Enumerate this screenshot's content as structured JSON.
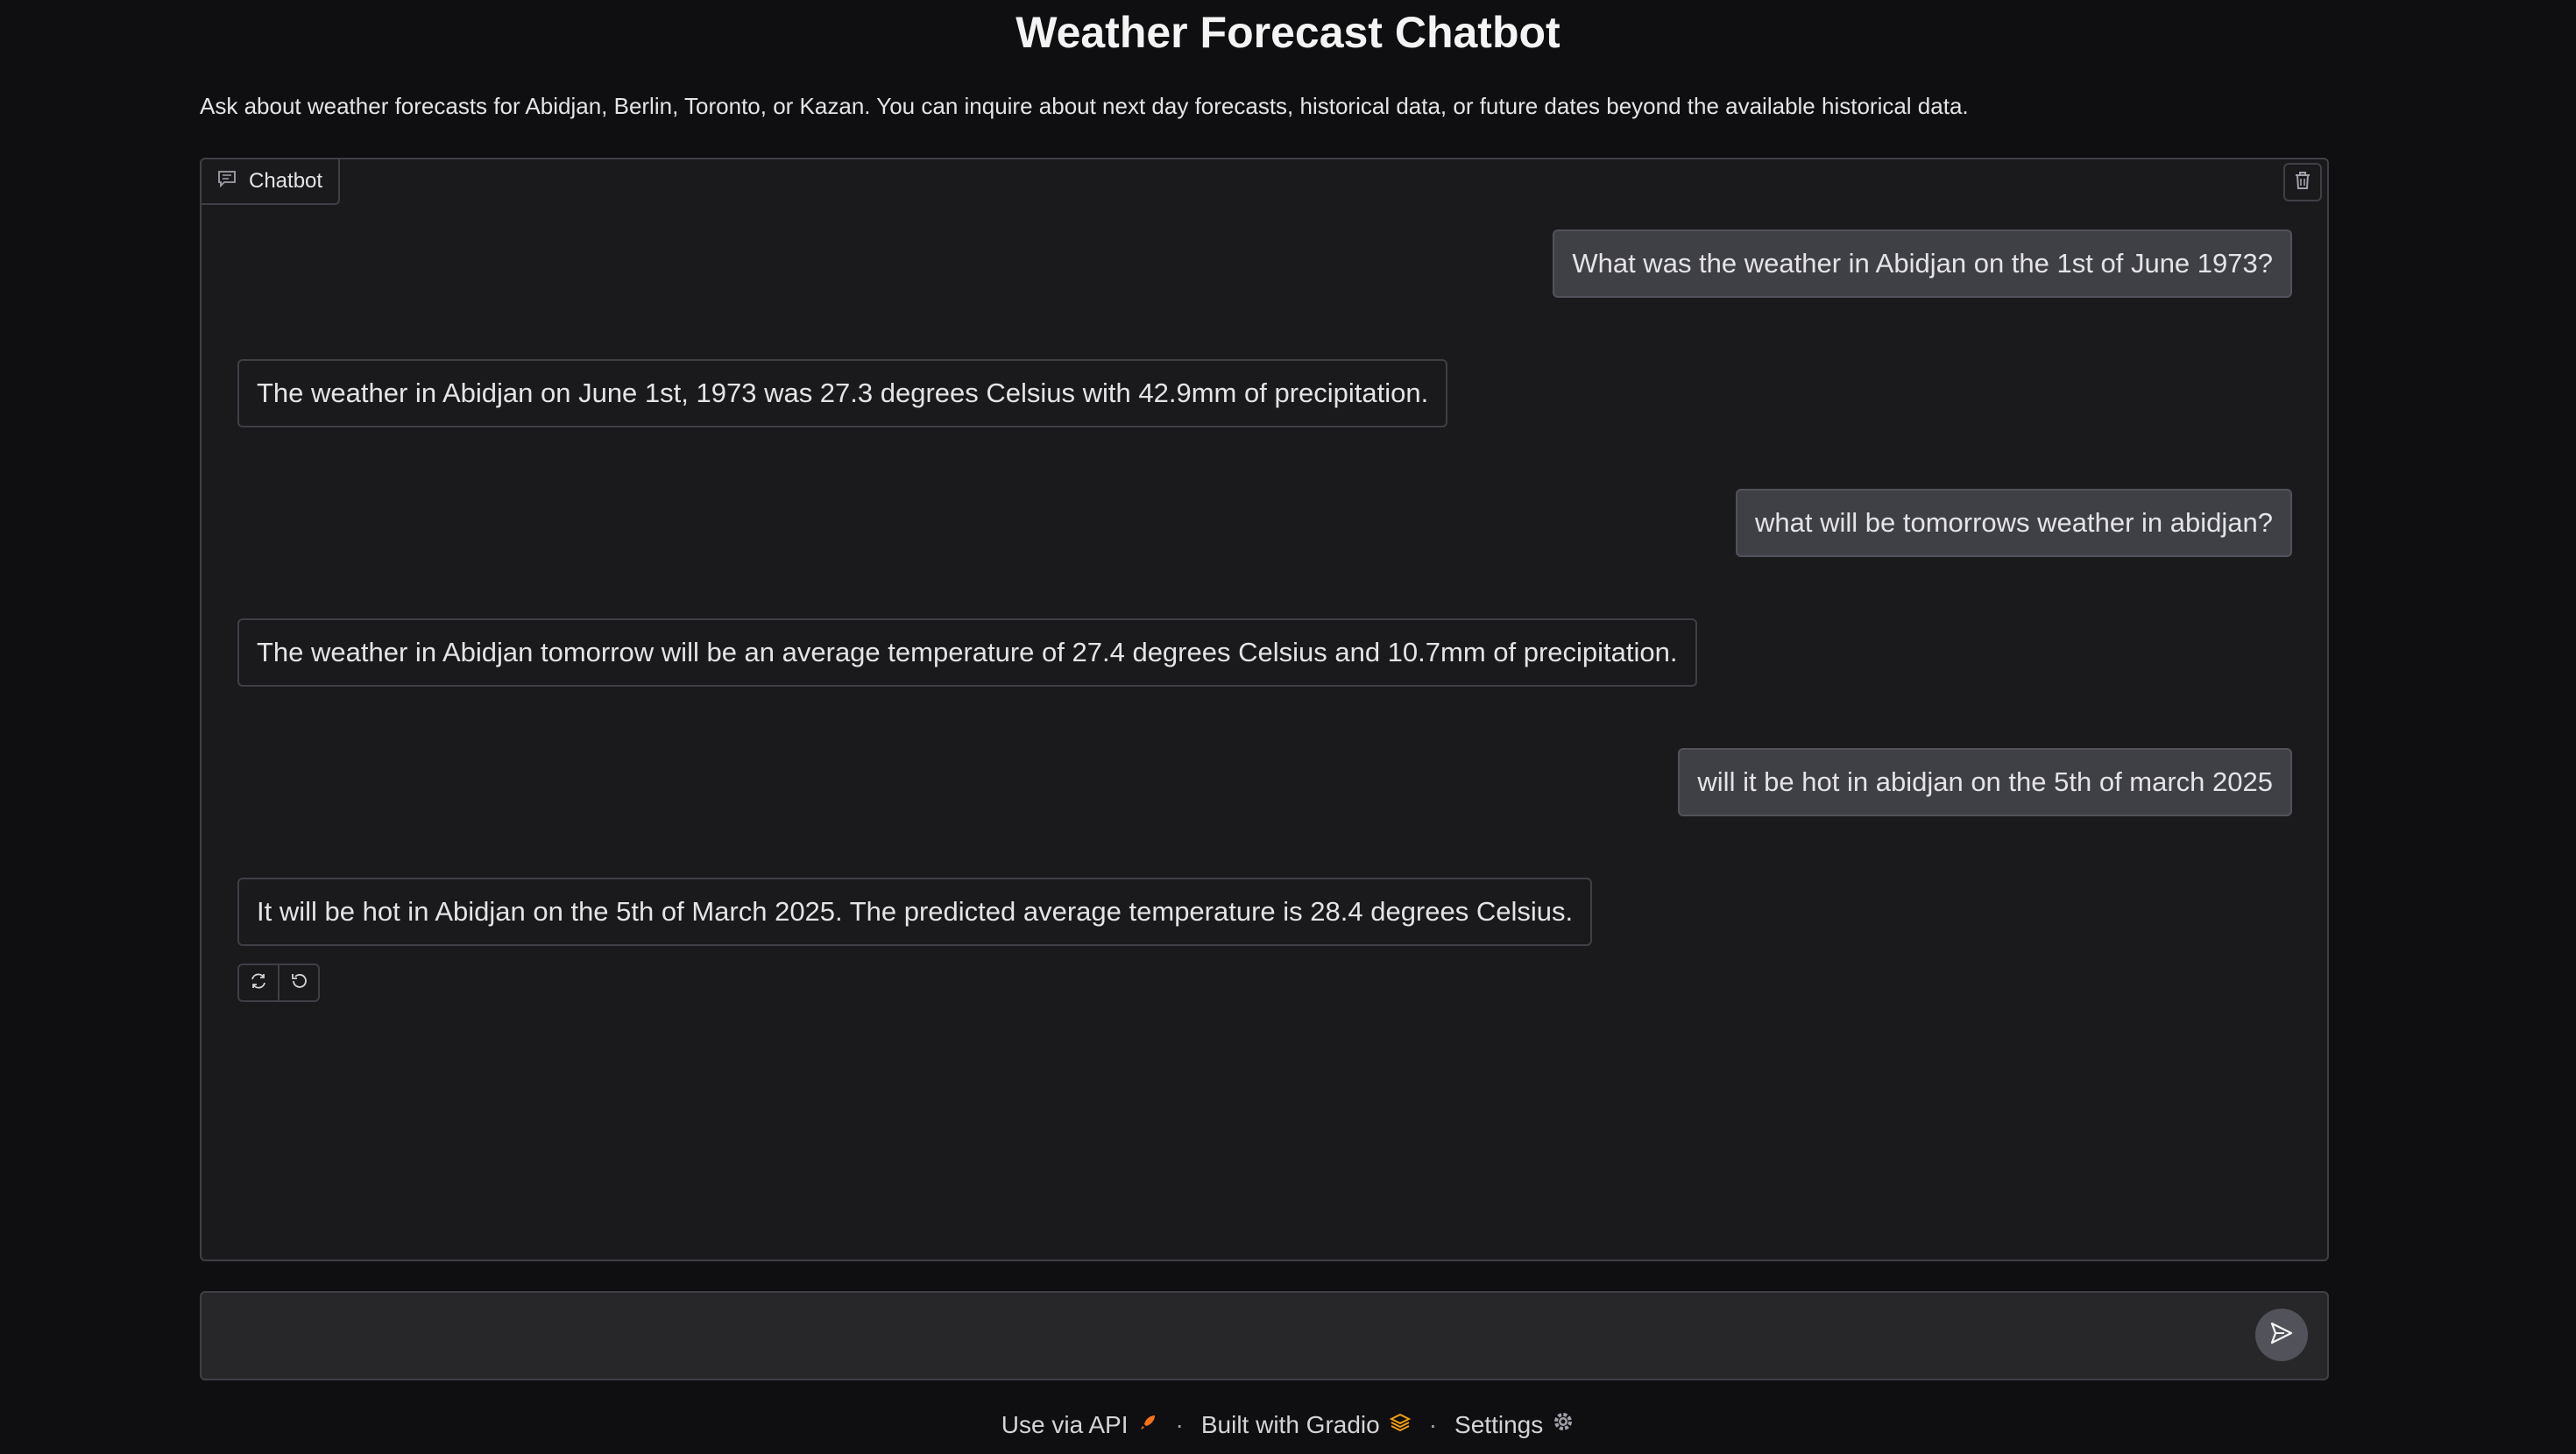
{
  "page": {
    "title": "Weather Forecast Chatbot",
    "description": "Ask about weather forecasts for Abidjan, Berlin, Toronto, or Kazan. You can inquire about next day forecasts, historical data, or future dates beyond the available historical data."
  },
  "chatbot": {
    "label": "Chatbot",
    "messages": [
      {
        "role": "user",
        "text": "What was the weather in Abidjan on the 1st of June 1973?"
      },
      {
        "role": "bot",
        "text": "The weather in Abidjan on June 1st, 1973 was 27.3 degrees Celsius with 42.9mm of precipitation."
      },
      {
        "role": "user",
        "text": "what will be tomorrows weather in abidjan?"
      },
      {
        "role": "bot",
        "text": "The weather in Abidjan tomorrow will be an average temperature of 27.4 degrees Celsius and 10.7mm of precipitation."
      },
      {
        "role": "user",
        "text": "will it be hot in abidjan on the 5th of march 2025"
      },
      {
        "role": "bot",
        "text": "It will be hot in Abidjan on the 5th of March 2025. The predicted average temperature is 28.4 degrees Celsius."
      }
    ]
  },
  "input": {
    "value": "",
    "placeholder": ""
  },
  "footer": {
    "api_label": "Use via API",
    "built_label": "Built with Gradio",
    "settings_label": "Settings",
    "separator": "·"
  },
  "icons": {
    "chat": "chat-bubble-icon",
    "trash": "trash-icon",
    "retry": "retry-icon",
    "undo": "undo-icon",
    "send": "send-icon",
    "rocket": "rocket-icon",
    "gradio": "gradio-logo-icon",
    "settings": "gear-icon"
  },
  "colors": {
    "rocket": "#f97316",
    "gradio": "#f59e0b"
  }
}
